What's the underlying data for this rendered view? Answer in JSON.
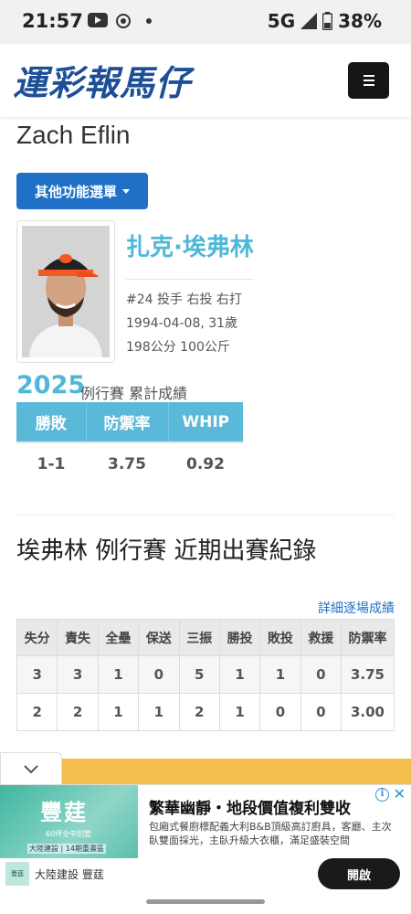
{
  "status_bar": {
    "time": "21:57",
    "network": "5G",
    "battery": "38%",
    "icons": [
      "youtube-icon",
      "record-icon",
      "dot-icon",
      "signal-icon",
      "battery-icon"
    ]
  },
  "header": {
    "logo_text": "運彩報馬仔",
    "menu_icon": "hamburger-icon"
  },
  "player": {
    "english_name": "Zach Eflin",
    "menu_button_label": "其他功能選單",
    "chinese_name": "扎克·埃弗林",
    "info_line1": "#24 投手 右投 右打",
    "info_line2": "1994-04-08, 31歲",
    "info_line3": "198公分 100公斤"
  },
  "season": {
    "year": "2025",
    "label": "例行賽 累計成績",
    "headers": [
      "勝敗",
      "防禦率",
      "WHIP"
    ],
    "values": [
      "1-1",
      "3.75",
      "0.92"
    ]
  },
  "recent": {
    "title": "埃弗林 例行賽 近期出賽紀錄",
    "detail_link": "詳細逐場成績",
    "headers": [
      "失分",
      "責失",
      "全壘",
      "保送",
      "三振",
      "勝投",
      "敗投",
      "救援",
      "防禦率"
    ],
    "rows": [
      [
        "3",
        "3",
        "1",
        "0",
        "5",
        "1",
        "1",
        "0",
        "3.75"
      ],
      [
        "2",
        "2",
        "1",
        "1",
        "2",
        "1",
        "0",
        "0",
        "3.00"
      ]
    ]
  },
  "ad": {
    "image_title": "豐莛",
    "image_sub": "60坪全中別墅",
    "image_sub2": "大陸建設 | 14期重畫區",
    "headline": "繁華幽靜・地段價值複利雙收",
    "body": "包廂式餐廚標配義大利B&B頂級高訂廚具，客廳、主次臥雙面採光，主臥升級大衣櫃，滿足盛裝空間",
    "brand_logo_text": "豐莛",
    "brand": "大陸建設 豐莛",
    "open_button": "開啟"
  }
}
